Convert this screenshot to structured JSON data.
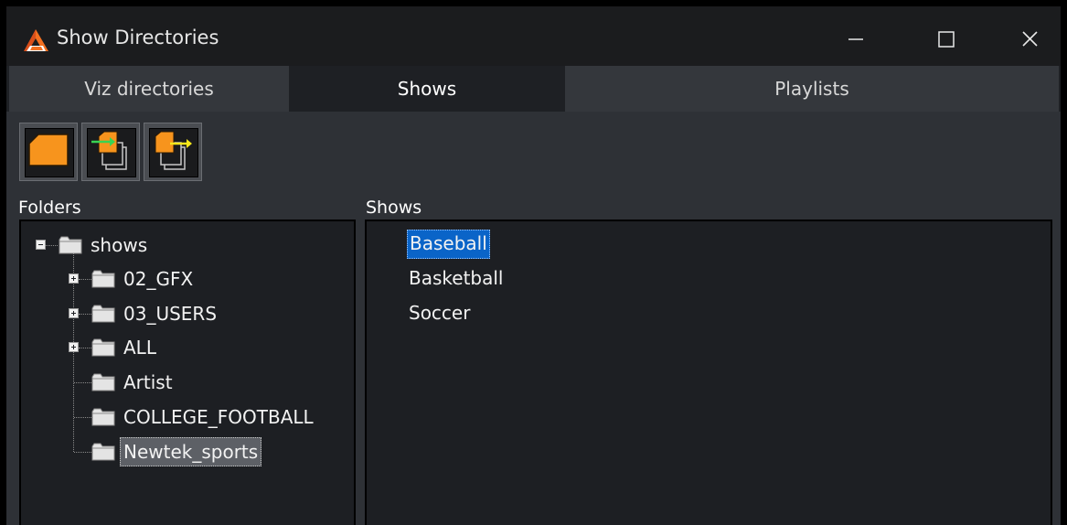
{
  "window": {
    "title": "Show Directories",
    "icon": "app-logo-icon",
    "controls": [
      "minimize-icon",
      "maximize-icon",
      "close-icon"
    ]
  },
  "tabs": [
    {
      "label": "Viz directories",
      "active": false
    },
    {
      "label": "Shows",
      "active": true
    },
    {
      "label": "Playlists",
      "active": false
    }
  ],
  "toolbar": {
    "buttons": [
      {
        "icon": "new-folder-icon"
      },
      {
        "icon": "import-icon"
      },
      {
        "icon": "export-icon"
      }
    ]
  },
  "folders": {
    "label": "Folders",
    "tree": [
      {
        "label": "shows",
        "level": 0,
        "expander": "minus"
      },
      {
        "label": "02_GFX",
        "level": 1,
        "expander": "plus"
      },
      {
        "label": "03_USERS",
        "level": 1,
        "expander": "plus"
      },
      {
        "label": "ALL",
        "level": 1,
        "expander": "plus"
      },
      {
        "label": "Artist",
        "level": 1,
        "expander": "none"
      },
      {
        "label": "COLLEGE_FOOTBALL",
        "level": 1,
        "expander": "none"
      },
      {
        "label": "Newtek_sports",
        "level": 1,
        "expander": "none",
        "selected": true
      }
    ]
  },
  "shows": {
    "label": "Shows",
    "items": [
      {
        "label": "Baseball",
        "selected": true
      },
      {
        "label": "Basketball",
        "selected": false
      },
      {
        "label": "Soccer",
        "selected": false
      }
    ]
  },
  "colors": {
    "accent_orange": "#f7941d",
    "selection_blue": "#0a64c8",
    "background": "#2e3136"
  }
}
